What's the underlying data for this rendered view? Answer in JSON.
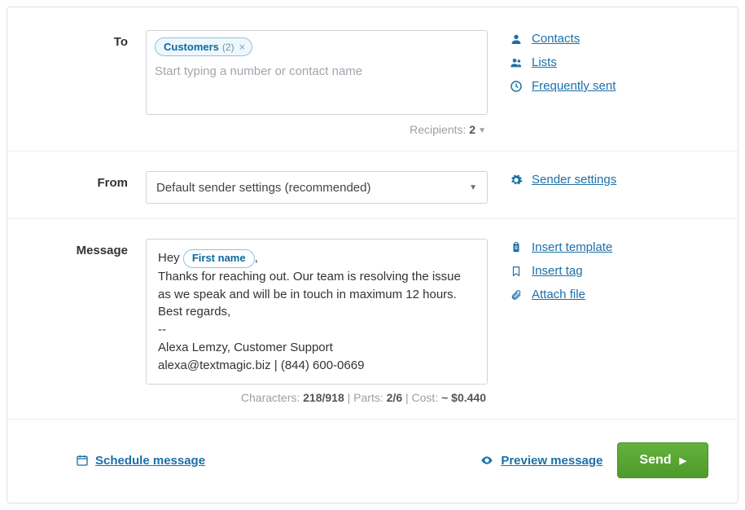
{
  "labels": {
    "to": "To",
    "from": "From",
    "message": "Message"
  },
  "to": {
    "chip_label": "Customers",
    "chip_count": "(2)",
    "placeholder": "Start typing a number or contact name",
    "recipients_prefix": "Recipients: ",
    "recipients_count": "2"
  },
  "to_links": {
    "contacts": "Contacts",
    "lists": "Lists",
    "frequent": "Frequently sent"
  },
  "from": {
    "selected": "Default sender settings (recommended)"
  },
  "from_links": {
    "settings": "Sender settings"
  },
  "message": {
    "text_before_tag": "Hey ",
    "tag": "First name",
    "text_after_tag_lines": [
      ",",
      "Thanks for reaching out. Our team is resolving the issue as we speak and will be in touch in maximum 12 hours.",
      "Best regards,",
      "--",
      "Alexa Lemzy, Customer Support",
      "alexa@textmagic.biz | (844) 600-0669"
    ],
    "stats": {
      "chars_label": "Characters: ",
      "chars_val": "218/918",
      "parts_label": "Parts: ",
      "parts_val": "2/6",
      "cost_label": "Cost: ",
      "cost_val": "~ $0.440",
      "sep": "  |  "
    }
  },
  "message_links": {
    "insert_template": "Insert template",
    "insert_tag": "Insert tag",
    "attach_file": "Attach file"
  },
  "footer": {
    "schedule": "Schedule message",
    "preview": "Preview message",
    "send": "Send"
  }
}
